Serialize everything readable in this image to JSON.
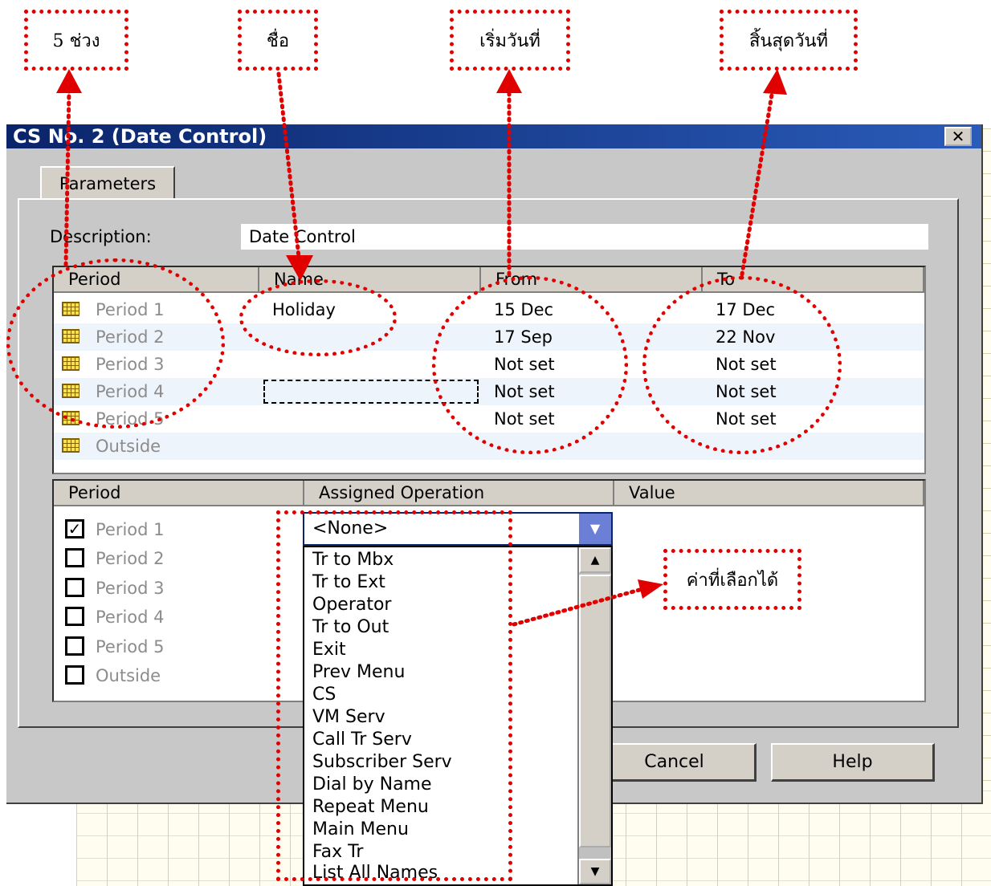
{
  "annotations": {
    "five_periods": "5 ช่วง",
    "name": "ชื่อ",
    "start_date": "เริ่มวันที่",
    "end_date": "สิ้นสุดวันที่",
    "selectable_values": "ค่าที่เลือกได้"
  },
  "dialog": {
    "title": "CS No. 2 (Date Control)",
    "close": "✕",
    "tab": "Parameters",
    "description_label": "Description:",
    "description_value": "Date Control"
  },
  "periods_table": {
    "headers": [
      "Period",
      "Name",
      "From",
      "To"
    ],
    "rows": [
      {
        "period": "Period 1",
        "name": "Holiday",
        "from": "15 Dec",
        "to": "17 Dec"
      },
      {
        "period": "Period 2",
        "name": "",
        "from": "17 Sep",
        "to": "22 Nov"
      },
      {
        "period": "Period 3",
        "name": "",
        "from": "Not set",
        "to": "Not set"
      },
      {
        "period": "Period 4",
        "name": "",
        "from": "Not set",
        "to": "Not set"
      },
      {
        "period": "Period 5",
        "name": "",
        "from": "Not set",
        "to": "Not set"
      },
      {
        "period": "Outside",
        "name": "",
        "from": "",
        "to": ""
      }
    ]
  },
  "operations_table": {
    "headers": [
      "Period",
      "Assigned Operation",
      "Value"
    ],
    "rows": [
      {
        "period": "Period 1",
        "checked": true
      },
      {
        "period": "Period 2",
        "checked": false
      },
      {
        "period": "Period 3",
        "checked": false
      },
      {
        "period": "Period 4",
        "checked": false
      },
      {
        "period": "Period 5",
        "checked": false
      },
      {
        "period": "Outside",
        "checked": false
      }
    ],
    "combo_value": "<None>",
    "options": [
      "Tr to Mbx",
      "Tr to Ext",
      "Operator",
      "Tr to Out",
      "Exit",
      "Prev Menu",
      "CS",
      "VM Serv",
      "Call Tr Serv",
      "Subscriber Serv",
      "Dial by Name",
      "Repeat Menu",
      "Main Menu",
      "Fax Tr",
      "List All Names"
    ]
  },
  "buttons": {
    "cancel": "Cancel",
    "help": "Help"
  },
  "colors": {
    "annotation_red": "#e00000",
    "titlebar": "#0a246a"
  }
}
